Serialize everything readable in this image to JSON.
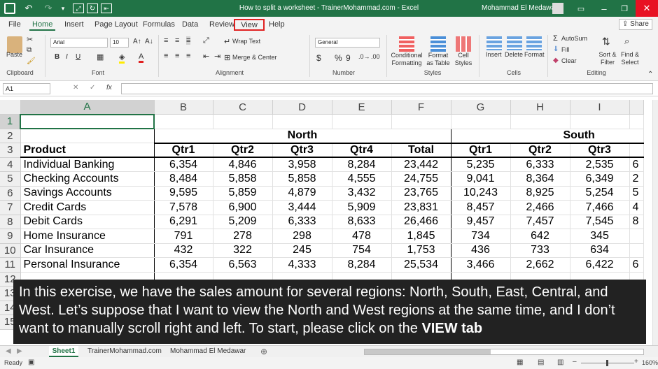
{
  "window": {
    "title": "How to split a worksheet - TrainerMohammad.com  -  Excel",
    "user": "Mohammad El Medawar"
  },
  "ribbon_tabs": [
    "File",
    "Home",
    "Insert",
    "Page Layout",
    "Formulas",
    "Data",
    "Review",
    "View",
    "Help"
  ],
  "share_label": "Share",
  "ribbon": {
    "clipboard": {
      "paste": "Paste",
      "group": "Clipboard"
    },
    "font": {
      "name": "Arial",
      "size": "10",
      "bold": "B",
      "italic": "I",
      "underline": "U",
      "group": "Font"
    },
    "alignment": {
      "wrap": "Wrap Text",
      "merge": "Merge & Center",
      "group": "Alignment"
    },
    "number": {
      "format": "General",
      "currency": "$",
      "percent": "%",
      "comma": "9",
      "group": "Number"
    },
    "styles": {
      "conditional": "Conditional Formatting",
      "format_table": "Format as Table",
      "cell_styles": "Cell Styles",
      "group": "Styles"
    },
    "cells": {
      "insert": "Insert",
      "delete": "Delete",
      "format": "Format",
      "group": "Cells"
    },
    "editing": {
      "autosum": "AutoSum",
      "fill": "Fill",
      "clear": "Clear",
      "sort": "Sort & Filter",
      "find": "Find & Select",
      "group": "Editing"
    }
  },
  "formula_bar": {
    "name_box": "A1",
    "fx": "fx",
    "value": ""
  },
  "columns": [
    "A",
    "B",
    "C",
    "D",
    "E",
    "F",
    "G",
    "H",
    "I"
  ],
  "row_numbers": [
    "1",
    "2",
    "3",
    "4",
    "5",
    "6",
    "7",
    "8",
    "9",
    "10",
    "11",
    "12",
    "13",
    "14",
    "15"
  ],
  "sheet": {
    "region_north": "North",
    "region_south": "South",
    "headers": [
      "Product",
      "Qtr1",
      "Qtr2",
      "Qtr3",
      "Qtr4",
      "Total",
      "Qtr1",
      "Qtr2",
      "Qtr3"
    ],
    "rows": [
      [
        "Individual Banking",
        "6,354",
        "4,846",
        "3,958",
        "8,284",
        "23,442",
        "5,235",
        "6,333",
        "2,535"
      ],
      [
        "Checking Accounts",
        "8,484",
        "5,858",
        "5,858",
        "4,555",
        "24,755",
        "9,041",
        "8,364",
        "6,349"
      ],
      [
        "Savings Accounts",
        "9,595",
        "5,859",
        "4,879",
        "3,432",
        "23,765",
        "10,243",
        "8,925",
        "5,254"
      ],
      [
        "Credit Cards",
        "7,578",
        "6,900",
        "3,444",
        "5,909",
        "23,831",
        "8,457",
        "2,466",
        "7,466"
      ],
      [
        "Debit Cards",
        "6,291",
        "5,209",
        "6,333",
        "8,633",
        "26,466",
        "9,457",
        "7,457",
        "7,545"
      ],
      [
        "Home Insurance",
        "791",
        "278",
        "298",
        "478",
        "1,845",
        "734",
        "642",
        "345"
      ],
      [
        "Car Insurance",
        "432",
        "322",
        "245",
        "754",
        "1,753",
        "436",
        "733",
        "634"
      ],
      [
        "Personal Insurance",
        "6,354",
        "6,563",
        "4,333",
        "8,284",
        "25,534",
        "3,466",
        "2,662",
        "6,422"
      ]
    ],
    "partial_col": [
      "6",
      "2",
      "5",
      "4",
      "8",
      "",
      "",
      "6"
    ]
  },
  "sheet_tabs": [
    "Sheet1",
    "TrainerMohammad.com",
    "Mohammad El Medawar"
  ],
  "status": {
    "ready": "Ready",
    "zoom": "160%"
  },
  "overlay": {
    "text_before": "In this exercise, we have the sales amount for several regions: North, South, East, Central, and West. Let’s suppose that I want to view the North and West regions at the same time, and I don’t want to manually scroll right and left. To start, please click on the ",
    "text_bold": "VIEW tab"
  },
  "colors": {
    "excel_green": "#217346",
    "highlight_red": "#e02020"
  }
}
